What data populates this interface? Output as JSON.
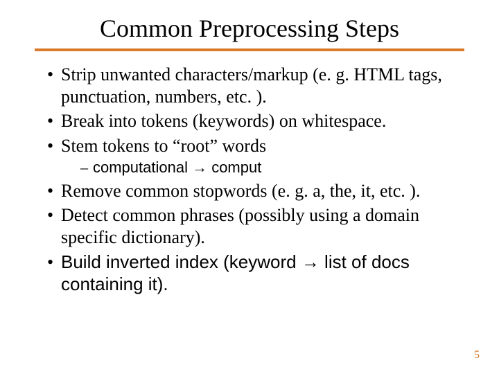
{
  "title": "Common Preprocessing Steps",
  "bullets": {
    "b1": "Strip unwanted characters/markup  (e. g. HTML tags, punctuation, numbers, etc. ).",
    "b2": "Break into tokens (keywords) on whitespace.",
    "b3": "Stem tokens to “root” words",
    "b3_sub": "computational → comput",
    "b4": "Remove common stopwords (e. g. a, the, it, etc. ).",
    "b5": "Detect common phrases (possibly using a domain specific dictionary).",
    "b6": "Build inverted index (keyword → list of docs containing it)."
  },
  "page_number": "5"
}
